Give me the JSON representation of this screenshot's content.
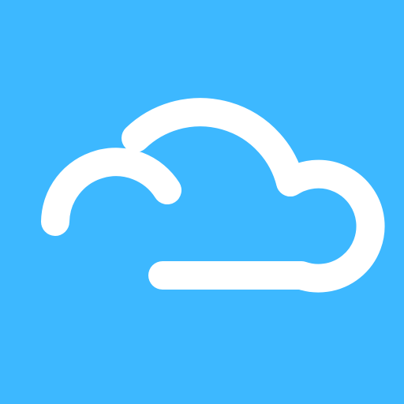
{
  "icon": {
    "name": "cloud-icon",
    "background_color": "#3DB8FF",
    "stroke_color": "#FFFFFF"
  }
}
